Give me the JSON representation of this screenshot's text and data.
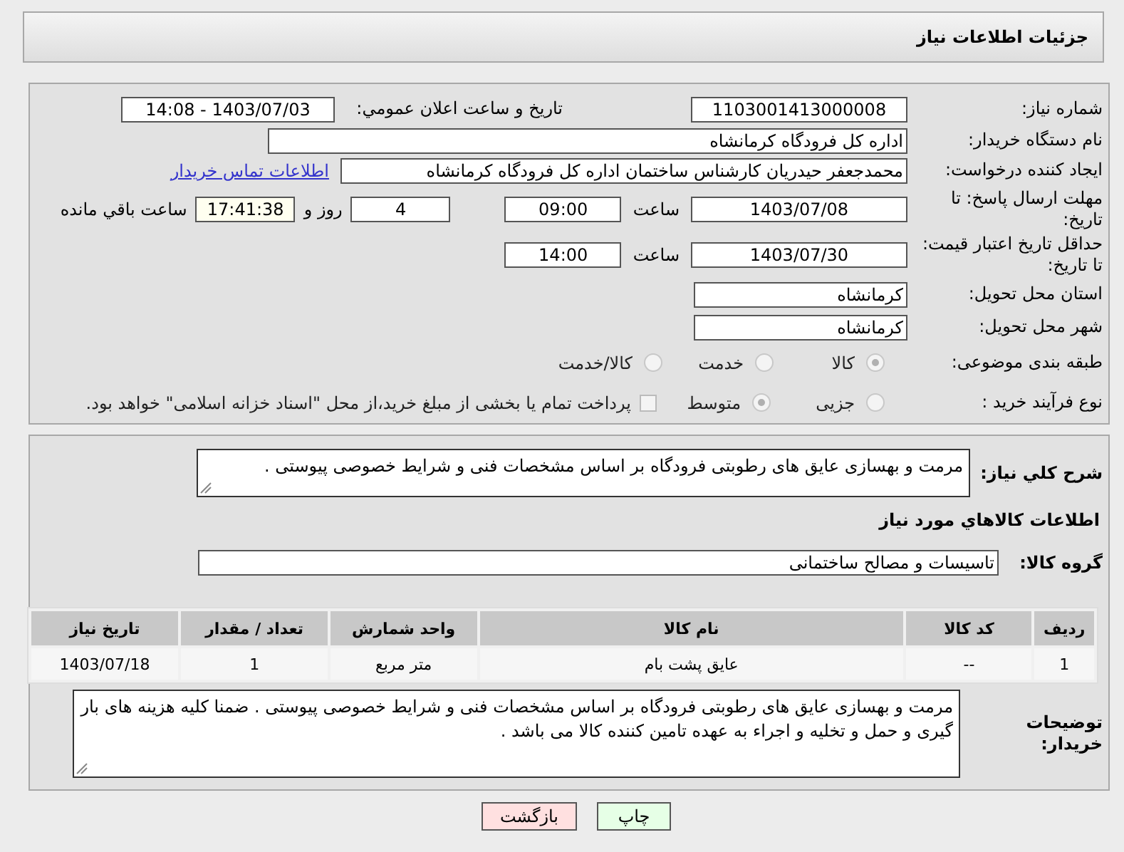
{
  "header": {
    "title": "جزئیات اطلاعات نیاز"
  },
  "need_number": {
    "label": "شماره نیاز:",
    "value": "1103001413000008"
  },
  "announce": {
    "label": "تاریخ و ساعت اعلان عمومي:",
    "value": "1403/07/03 - 14:08"
  },
  "buyer_org": {
    "label": "نام دستگاه خریدار:",
    "value": "اداره کل فرودگاه کرمانشاه"
  },
  "requester": {
    "label": "ایجاد کننده درخواست:",
    "value": "محمدجعفر حیدریان کارشناس ساختمان اداره کل فرودگاه کرمانشاه",
    "link": "اطلاعات تماس خریدار"
  },
  "reply_deadline": {
    "label": "مهلت ارسال پاسخ: تا تاریخ:",
    "date": "1403/07/08",
    "time_label": "ساعت",
    "time": "09:00",
    "days": "4",
    "days_label": "روز و",
    "remaining": "17:41:38",
    "remaining_label": "ساعت باقي مانده"
  },
  "price_validity": {
    "label": "حداقل تاریخ اعتبار قیمت: تا تاریخ:",
    "date": "1403/07/30",
    "time_label": "ساعت",
    "time": "14:00"
  },
  "province": {
    "label": "استان محل تحویل:",
    "value": "کرمانشاه"
  },
  "city": {
    "label": "شهر محل تحویل:",
    "value": "کرمانشاه"
  },
  "category": {
    "label": "طبقه بندی موضوعی:",
    "options": [
      {
        "label": "کالا",
        "selected": true
      },
      {
        "label": "خدمت",
        "selected": false
      },
      {
        "label": "کالا/خدمت",
        "selected": false
      }
    ]
  },
  "purchase_type": {
    "label": "نوع فرآیند خرید :",
    "options": [
      {
        "label": "جزیی",
        "selected": false
      },
      {
        "label": "متوسط",
        "selected": true
      }
    ],
    "treasury": {
      "label": "پرداخت تمام یا بخشی از مبلغ خرید،از محل \"اسناد خزانه اسلامی\" خواهد بود.",
      "checked": false
    }
  },
  "description": {
    "label": "شرح کلي نیاز:",
    "value": "مرمت و بهسازی عایق های رطوبتی فرودگاه بر اساس مشخصات فنی و شرایط خصوصی پیوستی ."
  },
  "goods_heading": "اطلاعات کالاهاي مورد نیاز",
  "goods_group": {
    "label": "گروه کالا:",
    "value": "تاسیسات و مصالح ساختمانی"
  },
  "table": {
    "columns": [
      "ردیف",
      "کد کالا",
      "نام کالا",
      "واحد شمارش",
      "تعداد / مقدار",
      "تاریخ نیاز"
    ],
    "rows": [
      [
        "1",
        "--",
        "عایق پشت بام",
        "متر مربع",
        "1",
        "1403/07/18"
      ]
    ]
  },
  "buyer_notes": {
    "label": "توضیحات خریدار:",
    "value": "مرمت و بهسازی عایق های رطوبتی فرودگاه بر اساس مشخصات فنی و شرایط خصوصی پیوستی . ضمنا کلیه هزینه های بار گیری و حمل و تخلیه و اجراء به عهده تامین کننده کالا می باشد ."
  },
  "buttons": [
    {
      "label": "چاپ",
      "kind": "print"
    },
    {
      "label": "بازگشت",
      "kind": "back"
    }
  ]
}
